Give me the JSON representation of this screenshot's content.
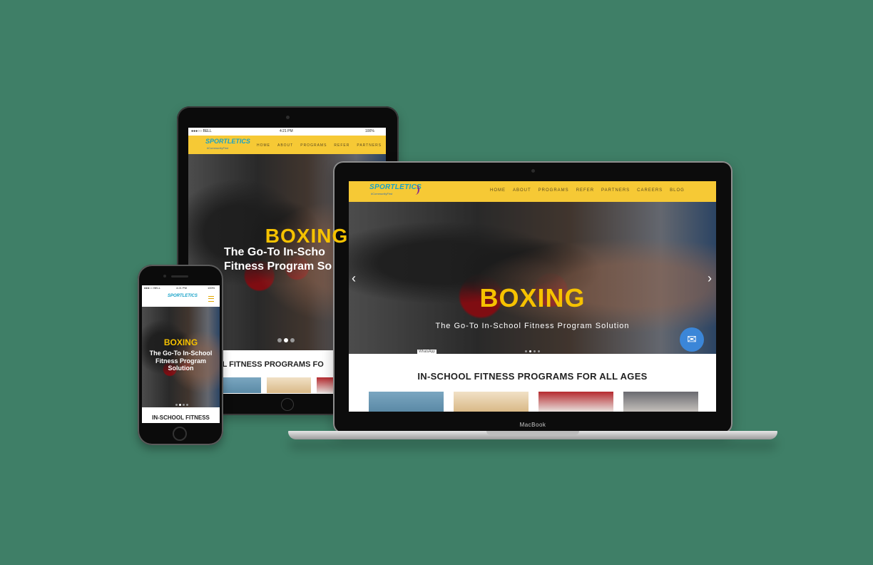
{
  "brand": {
    "logo": "SPORTLETICS",
    "tagline": "#CommunityFirst"
  },
  "laptop": {
    "device_label": "MacBook",
    "nav": [
      "HOME",
      "ABOUT",
      "PROGRAMS",
      "REFER",
      "PARTNERS",
      "CAREERS",
      "BLOG"
    ],
    "hero_title": "BOXING",
    "hero_subtitle": "The Go-To In-School Fitness Program Solution",
    "whatsapp_label": "WhatsApp",
    "section_title": "IN-SCHOOL FITNESS PROGRAMS FOR ALL AGES",
    "prev_arrow": "‹",
    "next_arrow": "›",
    "mail_icon": "✉"
  },
  "tablet": {
    "status": {
      "carrier": "●●●○○ BELL",
      "time": "4:21 PM",
      "battery": "100%"
    },
    "nav": [
      "HOME",
      "ABOUT",
      "PROGRAMS",
      "REFER",
      "PARTNERS"
    ],
    "hero_title": "BOXING",
    "hero_subtitle_line1": "The Go-To In-Scho",
    "hero_subtitle_line2": "Fitness Program So",
    "section_title": "SCHOOL FITNESS PROGRAMS FO"
  },
  "phone": {
    "status": {
      "carrier": "●●●○○ BELL",
      "time": "4:21 PM",
      "battery": "100%"
    },
    "hero_title": "BOXING",
    "hero_subtitle": "The Go-To In-School Fitness Program Solution",
    "section_title": "IN-SCHOOL FITNESS"
  },
  "colors": {
    "background": "#3f7f67",
    "nav_yellow": "#f6c935",
    "hero_title": "#f6c200",
    "logo_blue": "#17a2c8",
    "mail_button": "#3b86d8"
  }
}
